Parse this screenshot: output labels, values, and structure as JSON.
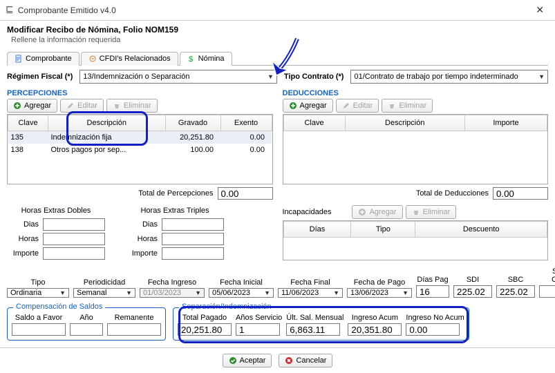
{
  "titlebar": {
    "app": "Comprobante Emitido v4.0"
  },
  "subhead": {
    "title": "Modificar Recibo de Nómina, Folio NOM159",
    "sub": "Rellene la información requerida"
  },
  "tabs": {
    "t1": "Comprobante",
    "t2": "CFDI's Relacionados",
    "t3": "Nómina"
  },
  "top": {
    "regimen_lbl": "Régimen Fiscal (*)",
    "regimen_val": "13/Indemnización o Separación",
    "tipo_lbl": "Tipo Contrato (*)",
    "tipo_val": "01/Contrato de trabajo por tiempo indeterminado"
  },
  "percep": {
    "title": "PERCEPCIONES",
    "btn_add": "Agregar",
    "btn_edit": "Editar",
    "btn_del": "Eliminar",
    "cols": {
      "c1": "Clave",
      "c2": "Descripción",
      "c3": "Gravado",
      "c4": "Exento"
    },
    "rows": [
      {
        "clave": "135",
        "desc": "Indemnización fija",
        "grav": "20,251.80",
        "ex": "0.00"
      },
      {
        "clave": "138",
        "desc": "Otros pagos por sep...",
        "grav": "100.00",
        "ex": "0.00"
      }
    ],
    "total_lbl": "Total de Percepciones",
    "total_val": "0.00"
  },
  "deduc": {
    "title": "DEDUCCIONES",
    "btn_add": "Agregar",
    "btn_edit": "Editar",
    "btn_del": "Eliminar",
    "cols": {
      "c1": "Clave",
      "c2": "Descripción",
      "c3": "Importe"
    },
    "total_lbl": "Total de Deducciones",
    "total_val": "0.00"
  },
  "horas": {
    "dobles": "Horas Extras Dobles",
    "triples": "Horas Extras Triples",
    "dias": "Dias",
    "horas": "Horas",
    "importe": "Importe"
  },
  "incap": {
    "title": "Incapacidades",
    "btn_add": "Agregar",
    "btn_del": "Eliminar",
    "cols": {
      "c1": "Días",
      "c2": "Tipo",
      "c3": "Descuento"
    }
  },
  "bigrow": {
    "tipo": "Tipo",
    "tipo_val": "Ordinaria",
    "period": "Periodicidad",
    "period_val": "Semanal",
    "fing": "Fecha Ingreso",
    "fing_val": "01/03/2023",
    "fini": "Fecha Inicial",
    "fini_val": "05/06/2023",
    "ffin": "Fecha Final",
    "ffin_val": "11/06/2023",
    "fpago": "Fecha de Pago",
    "fpago_val": "13/06/2023",
    "diaspag": "Días Pag",
    "diaspag_val": "16",
    "sdi": "SDI",
    "sdi_val": "225.02",
    "sbc": "SBC",
    "sbc_val": "225.02",
    "subs": "Subsidio Causado",
    "subs_val": ""
  },
  "comp": {
    "legend": "Compensación de Saldos",
    "saldo": "Saldo a Favor",
    "ano": "Año",
    "reman": "Remanente"
  },
  "sep": {
    "legend": "Separación/Indemnización",
    "totpag": "Total Pagado",
    "totpag_val": "20,251.80",
    "anos": "Años Servicio",
    "anos_val": "1",
    "ult": "Últ. Sal. Mensual",
    "ult_val": "6,863.11",
    "iacum": "Ingreso Acum",
    "iacum_val": "20,351.80",
    "inacum": "Ingreso No Acum",
    "inacum_val": "0.00"
  },
  "bottom": {
    "ok": "Aceptar",
    "cancel": "Cancelar"
  }
}
